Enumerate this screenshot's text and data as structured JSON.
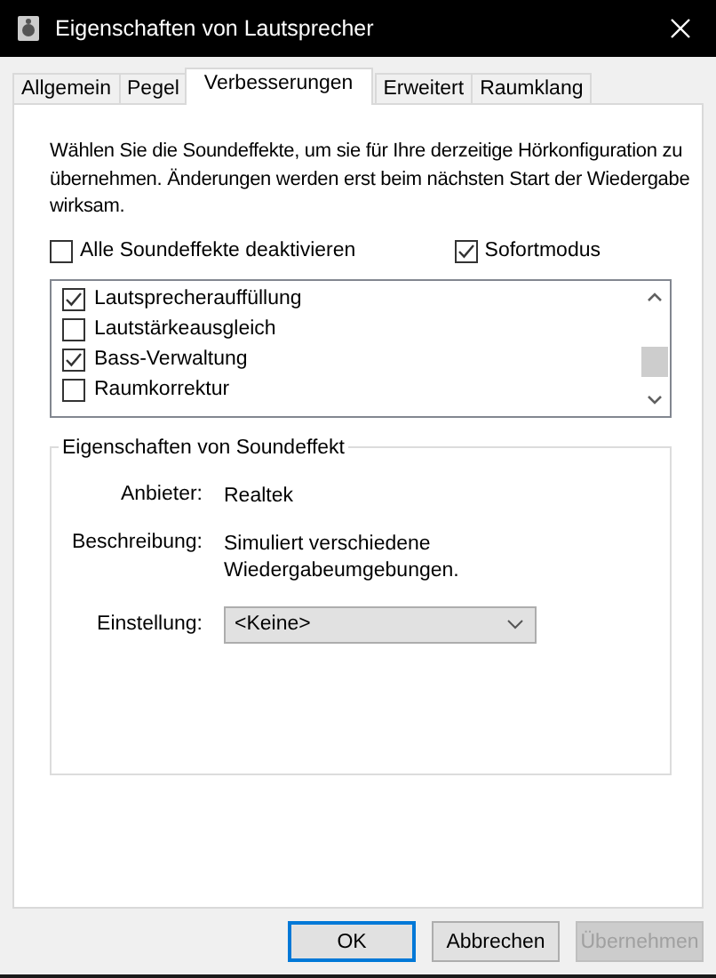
{
  "window": {
    "title": "Eigenschaften von Lautsprecher"
  },
  "tabs": [
    {
      "label": "Allgemein",
      "selected": false
    },
    {
      "label": "Pegel",
      "selected": false
    },
    {
      "label": "Verbesserungen",
      "selected": true
    },
    {
      "label": "Erweitert",
      "selected": false
    },
    {
      "label": "Raumklang",
      "selected": false
    }
  ],
  "intro": "Wählen Sie die Soundeffekte, um sie für Ihre derzeitige Hörkonfiguration zu übernehmen. Änderungen werden erst beim nächsten Start der Wiedergabe wirksam.",
  "options": [
    {
      "label": "Alle Soundeffekte deaktivieren",
      "checked": false
    },
    {
      "label": "Sofortmodus",
      "checked": true
    }
  ],
  "effects": [
    {
      "label": "Lautsprecherauffüllung",
      "checked": true
    },
    {
      "label": "Lautstärkeausgleich",
      "checked": false
    },
    {
      "label": "Bass-Verwaltung",
      "checked": true
    },
    {
      "label": "Raumkorrektur",
      "checked": false
    }
  ],
  "group": {
    "title": "Eigenschaften von Soundeffekt",
    "fields": [
      {
        "label": "Anbieter:",
        "value": "Realtek"
      },
      {
        "label": "Beschreibung:",
        "value": "Simuliert verschiedene Wiedergabeumgebungen."
      }
    ],
    "setting": {
      "label": "Einstellung:",
      "value": "<Keine>"
    }
  },
  "buttons": [
    {
      "label": "OK",
      "default": true,
      "disabled": false
    },
    {
      "label": "Abbrechen",
      "default": false,
      "disabled": false
    },
    {
      "label": "Übernehmen",
      "default": false,
      "disabled": true
    }
  ]
}
